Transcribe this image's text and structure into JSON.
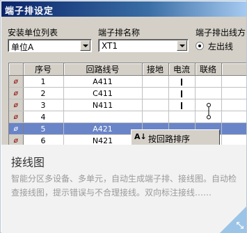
{
  "window": {
    "title": "端子排设定"
  },
  "fields": {
    "unit_list_label": "安装单位列表",
    "unit_value": "单位A",
    "terminal_name_label": "端子排名称",
    "terminal_value": "XT1",
    "direction_label": "端子排出线方",
    "direction_option": "左出线"
  },
  "table": {
    "headers": [
      "序号",
      "回路线号",
      "接地",
      "电流",
      "联络"
    ],
    "rows": [
      {
        "ind": "ø",
        "no": "1",
        "loop": "A411",
        "ground": "",
        "current": "bar",
        "link": ""
      },
      {
        "ind": "ø",
        "no": "2",
        "loop": "C411",
        "ground": "",
        "current": "bar",
        "link": ""
      },
      {
        "ind": "ø",
        "no": "3",
        "loop": "N411",
        "ground": "",
        "current": "bar",
        "link": "top"
      },
      {
        "ind": "ø",
        "no": "4",
        "loop": "",
        "ground": "",
        "current": "",
        "link": "bottom"
      },
      {
        "ind": "ø",
        "no": "5",
        "loop": "A421",
        "ground": "",
        "current": "",
        "link": ""
      },
      {
        "ind": "ø",
        "no": "6",
        "loop": "N421",
        "ground": "",
        "current": "",
        "link": ""
      }
    ]
  },
  "context_menu": {
    "icon": "A↓",
    "item": "按回路排序"
  },
  "card": {
    "title": "接线图",
    "description": "智能分区多设备、多单元，自动生成端子排、接线图。自动检查接线图，提示错误与不合理接线。双向标注接线……"
  },
  "colors": {
    "selection": "#6a84c8",
    "corner": "#9cc4e6"
  }
}
